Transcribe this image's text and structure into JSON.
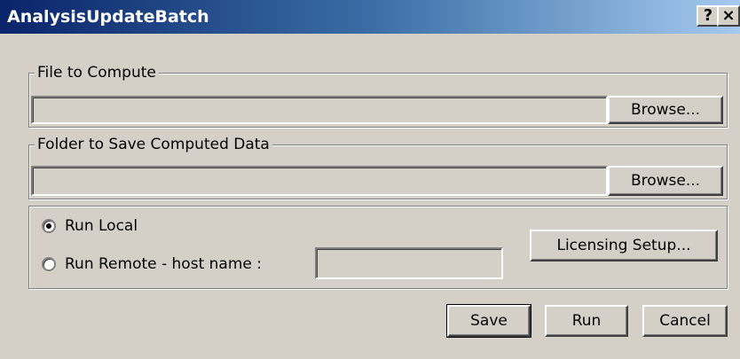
{
  "window": {
    "title": "AnalysisUpdateBatch",
    "help_button": "?",
    "close_button": "×"
  },
  "file_to_compute": {
    "label": "File to Compute",
    "value": "",
    "browse_label": "Browse..."
  },
  "folder_to_save": {
    "label": "Folder to Save Computed Data",
    "value": "",
    "browse_label": "Browse..."
  },
  "run_options": {
    "run_local_label": "Run Local",
    "run_local_checked": true,
    "run_remote_label": "Run Remote - host name :",
    "run_remote_checked": false,
    "host_name_value": "",
    "licensing_setup_label": "Licensing Setup..."
  },
  "actions": {
    "save_label": "Save",
    "run_label": "Run",
    "cancel_label": "Cancel"
  }
}
